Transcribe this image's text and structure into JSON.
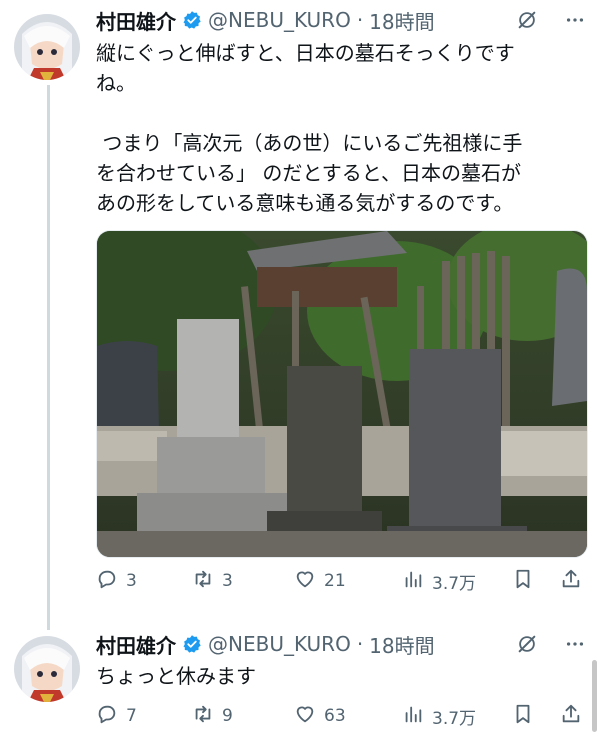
{
  "tweet1": {
    "name": "村田雄介",
    "handle": "@NEBU_KURO",
    "separator": "·",
    "time": "18時間",
    "text": "縦にぐっと伸ばすと、日本の墓石そっくりです\nね。\n\n つまり「高次元（あの世）にいるご先祖様に手\nを合わせている」 のだとすると、日本の墓石が\nあの形をしている意味も通る気がするのです。",
    "replies": "3",
    "reposts": "3",
    "likes": "21",
    "views": "3.7万"
  },
  "tweet2": {
    "name": "村田雄介",
    "handle": "@NEBU_KURO",
    "separator": "·",
    "time": "18時間",
    "text": "ちょっと休みます",
    "replies": "7",
    "reposts": "9",
    "likes": "63",
    "views": "3.7万"
  },
  "colors": {
    "verified": "#1d9bf0",
    "muted": "#536471",
    "thread_line": "#cfd9de"
  },
  "icons": [
    "verified-badge-icon",
    "grok-icon",
    "more-icon",
    "reply-icon",
    "repost-icon",
    "like-icon",
    "views-icon",
    "bookmark-icon",
    "share-icon"
  ]
}
